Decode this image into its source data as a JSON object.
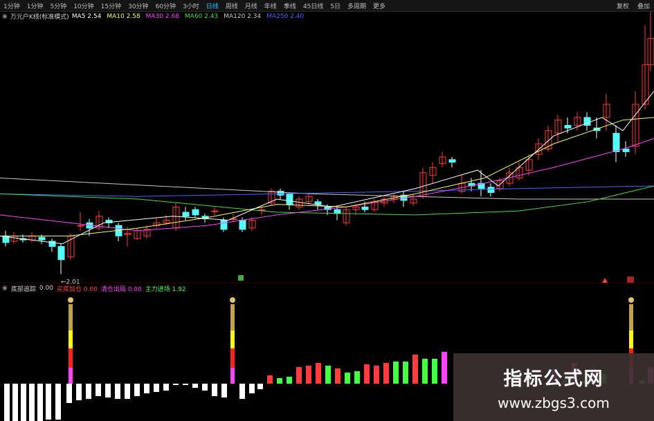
{
  "toolbar": {
    "periods": [
      "1分钟",
      "1分钟",
      "5分钟",
      "10分钟",
      "15分钟",
      "30分钟",
      "60分钟",
      "3小时",
      "日线",
      "周线",
      "月线",
      "年线",
      "季线",
      "45日线",
      "5日",
      "多周期",
      "更多"
    ],
    "active_period_index": 8,
    "right_items": [
      "复权",
      "叠加"
    ]
  },
  "ma_legend": {
    "title": "万元户K线(标准模式)",
    "items": [
      {
        "label": "MA5",
        "value": "2.54",
        "color": "#ffffff"
      },
      {
        "label": "MA10",
        "value": "2.58",
        "color": "#ffff55"
      },
      {
        "label": "MA30",
        "value": "2.68",
        "color": "#ff44ff"
      },
      {
        "label": "MA60",
        "value": "2.43",
        "color": "#44dd44"
      },
      {
        "label": "MA120",
        "value": "2.34",
        "color": "#c8c8c8"
      },
      {
        "label": "MA250",
        "value": "2.40",
        "color": "#4466ff"
      }
    ]
  },
  "min_price_label": "2.01",
  "sub_legend": {
    "title": "底部追踪",
    "items": [
      {
        "label": "买底加仓",
        "value": "0.00",
        "color": "#ff4444"
      },
      {
        "label": "清仓出局",
        "value": "0.00",
        "color": "#ff44ff"
      },
      {
        "label": "主力进场",
        "value": "1.92",
        "color": "#44ff44"
      }
    ],
    "first_value": "0.00"
  },
  "watermark": {
    "title": "指标公式网",
    "url": "www.zbgs3.com"
  },
  "colors": {
    "up": "#ff3c3c",
    "down": "#54fcfc",
    "bg": "#000000"
  }
}
